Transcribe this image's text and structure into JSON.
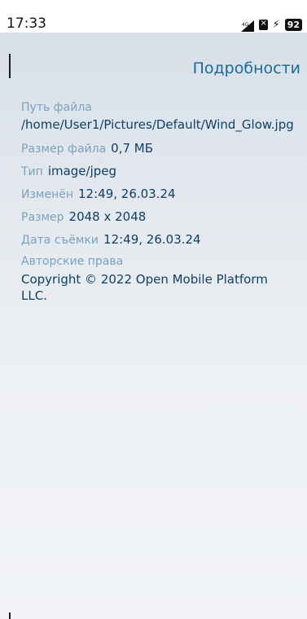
{
  "status_bar": {
    "time": "17:33",
    "network": "4G",
    "battery": "92",
    "icons": [
      "signal-icon",
      "sim-icon",
      "charging-bolt-icon",
      "battery-badge"
    ]
  },
  "header": {
    "title": "Подробности"
  },
  "details": {
    "path": {
      "label": "Путь файла",
      "value": "/home/User1/Pictures/Default/Wind_Glow.jpg"
    },
    "size_file": {
      "label": "Размер файла",
      "value": "0,7 МБ"
    },
    "type": {
      "label": "Тип",
      "value": "image/jpeg"
    },
    "modified": {
      "label": "Изменён",
      "value": "12:49, 26.03.24"
    },
    "dimensions": {
      "label": "Размер",
      "value": "2048 x 2048"
    },
    "taken": {
      "label": "Дата съёмки",
      "value": "12:49, 26.03.24"
    },
    "copyright": {
      "label": "Авторские права",
      "value": "Copyright © 2022  Open Mobile Platform LLC."
    }
  }
}
